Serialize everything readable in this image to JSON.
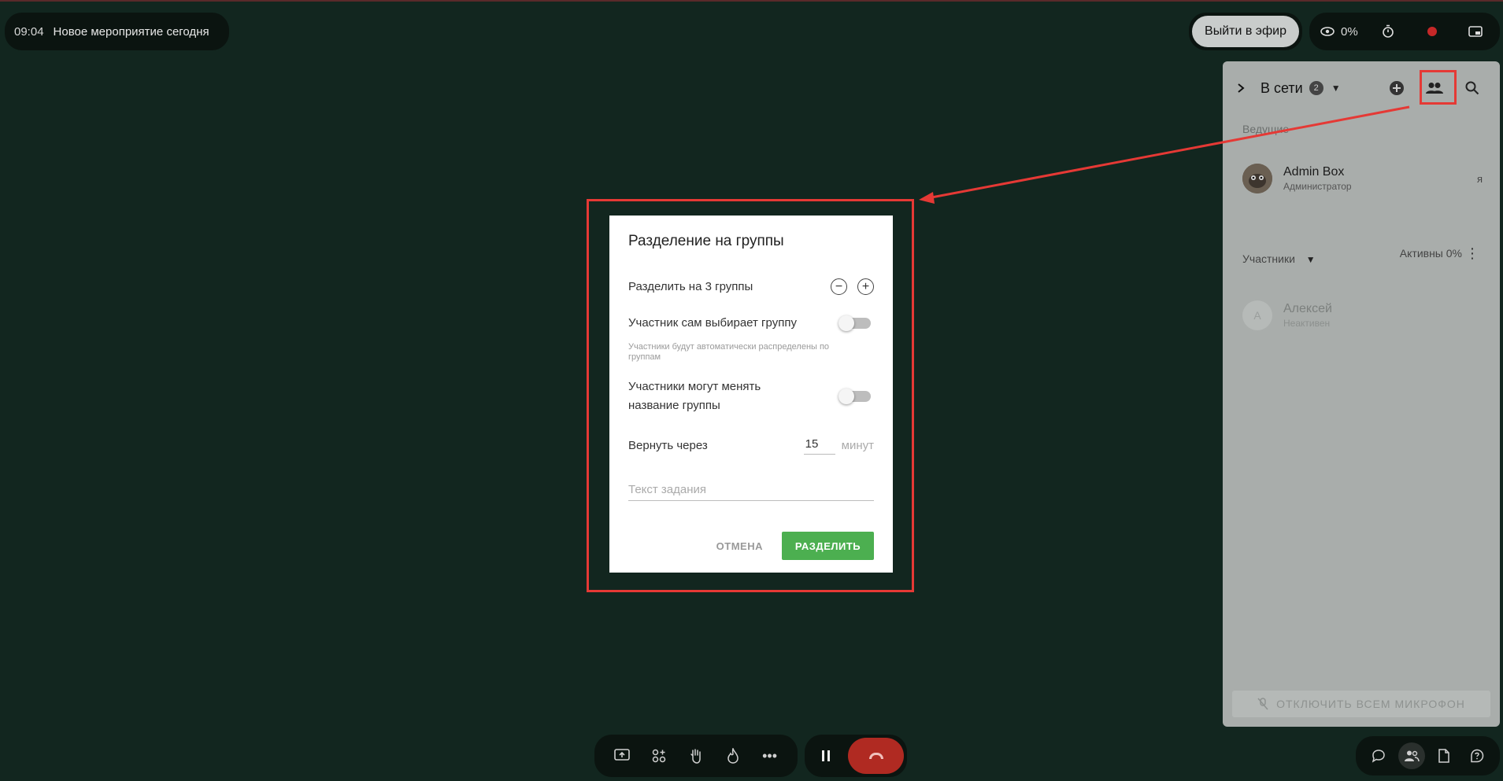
{
  "event": {
    "time": "09:04",
    "title": "Новое мероприятие сегодня"
  },
  "top": {
    "go_live": "Выйти в эфир",
    "viewers": "0%"
  },
  "panel": {
    "title": "В сети",
    "online_count": "2",
    "hosts_label": "Ведущие",
    "host": {
      "name": "Admin Box",
      "role": "Администратор",
      "me": "я"
    },
    "participants_label": "Участники",
    "active": "Активны 0%",
    "participant": {
      "initial": "А",
      "name": "Алексей",
      "status": "Неактивен"
    },
    "mute_all": "ОТКЛЮЧИТЬ ВСЕМ МИКРОФОН"
  },
  "dialog": {
    "title": "Разделение на группы",
    "split_label": "Разделить на 3 группы",
    "self_choose_label": "Участник сам выбирает группу",
    "self_choose_hint": "Участники будут автоматически распределены по группам",
    "rename_label_1": "Участники могут менять",
    "rename_label_2": "название группы",
    "return_label": "Вернуть через",
    "return_value": "15",
    "return_unit": "минут",
    "task_placeholder": "Текст задания",
    "cancel": "ОТМЕНА",
    "submit": "РАЗДЕЛИТЬ"
  },
  "colors": {
    "background": "#12261f",
    "accent_green": "#4caf50",
    "hangup_red": "#b02a22",
    "highlight_red": "#e53935"
  }
}
